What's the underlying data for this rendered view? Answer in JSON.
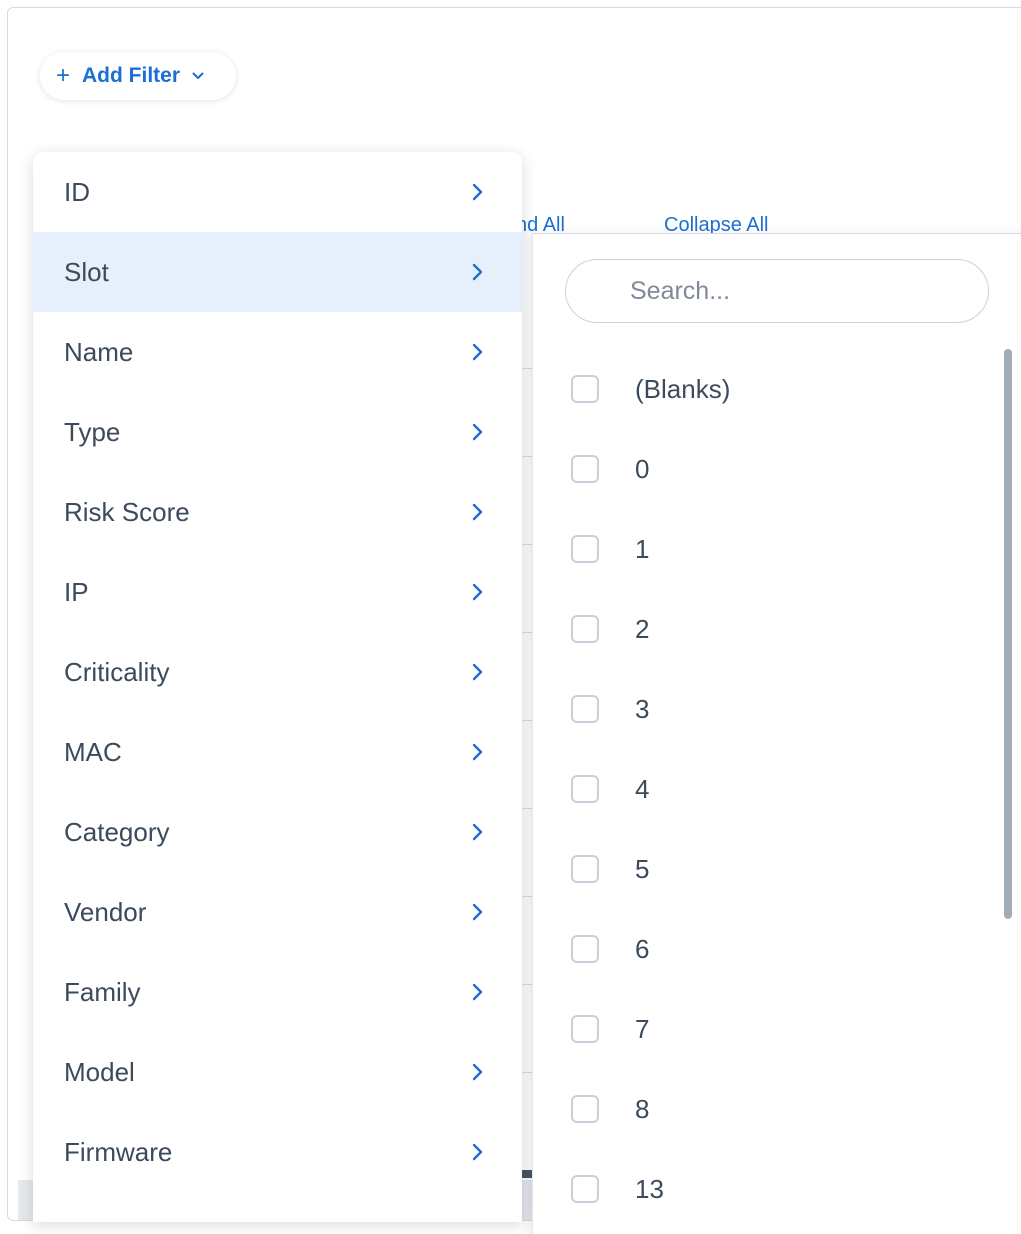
{
  "toolbar": {
    "add_filter_label": "Add Filter"
  },
  "background": {
    "expand_all": "nd All",
    "collapse_all": "Collapse All"
  },
  "field_menu": {
    "items": [
      {
        "label": "ID"
      },
      {
        "label": "Slot",
        "active": true
      },
      {
        "label": "Name"
      },
      {
        "label": "Type"
      },
      {
        "label": "Risk Score"
      },
      {
        "label": "IP"
      },
      {
        "label": "Criticality"
      },
      {
        "label": "MAC"
      },
      {
        "label": "Category"
      },
      {
        "label": "Vendor"
      },
      {
        "label": "Family"
      },
      {
        "label": "Model"
      },
      {
        "label": "Firmware"
      }
    ]
  },
  "value_panel": {
    "search_placeholder": "Search...",
    "values": [
      {
        "label": "(Blanks)",
        "checked": false
      },
      {
        "label": "0",
        "checked": false
      },
      {
        "label": "1",
        "checked": false
      },
      {
        "label": "2",
        "checked": false
      },
      {
        "label": "3",
        "checked": false
      },
      {
        "label": "4",
        "checked": false
      },
      {
        "label": "5",
        "checked": false
      },
      {
        "label": "6",
        "checked": false
      },
      {
        "label": "7",
        "checked": false
      },
      {
        "label": "8",
        "checked": false
      },
      {
        "label": "13",
        "checked": false
      }
    ]
  },
  "colors": {
    "accent": "#1b6fd1",
    "active_row": "#e6f0fc",
    "text": "#3d4a5c"
  },
  "icons": {
    "add": "plus-icon",
    "dropdown": "chevron-down-icon",
    "submenu": "chevron-right-icon"
  }
}
